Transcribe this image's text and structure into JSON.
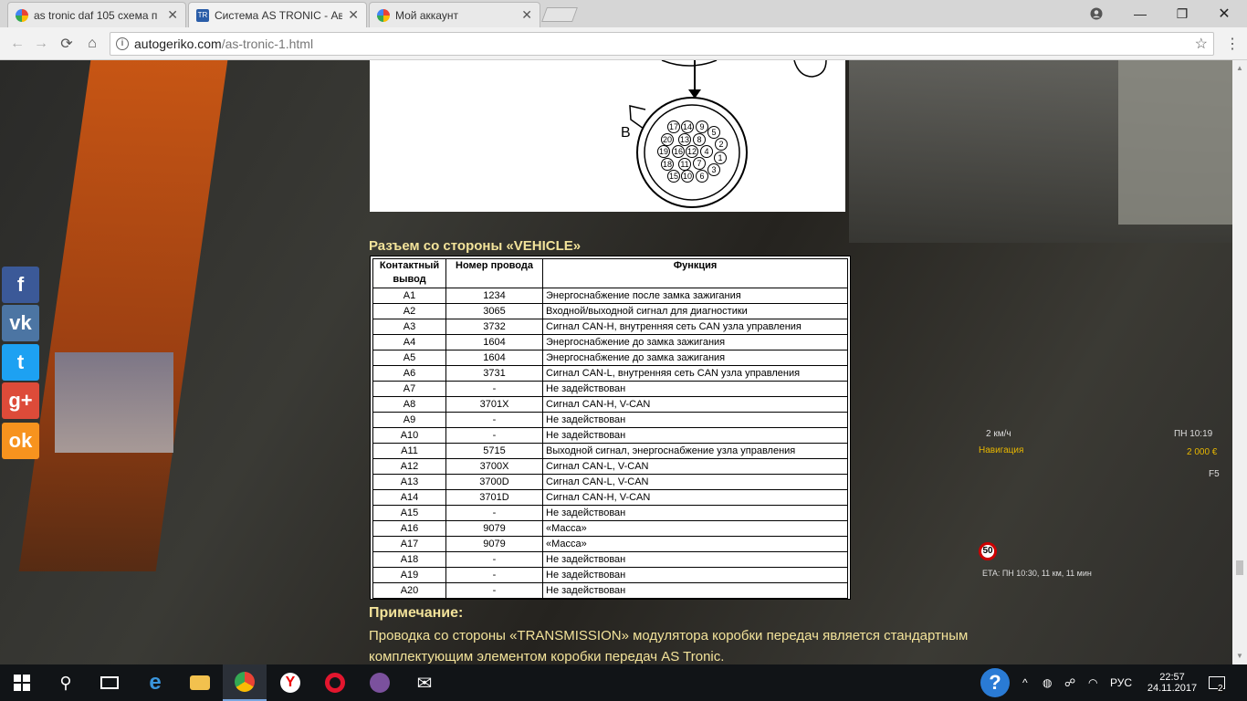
{
  "browser": {
    "tabs": [
      {
        "title": "as tronic daf 105 схема п",
        "favicon_color": "#4285f4"
      },
      {
        "title": "Система AS TRONIC - Ав",
        "favicon_color": "#2a5da8"
      },
      {
        "title": "Мой аккаунт",
        "favicon_color": "#4285f4"
      }
    ],
    "url_host": "autogeriko.com",
    "url_path": "/as-tronic-1.html"
  },
  "page": {
    "connector_label": "B",
    "section_heading": "Разъем со стороны «VEHICLE»",
    "table": {
      "headers": [
        "Контактный вывод",
        "Номер провода",
        "Функция"
      ],
      "rows": [
        [
          "A1",
          "1234",
          "Энергоснабжение после замка зажигания"
        ],
        [
          "A2",
          "3065",
          "Входной/выходной сигнал для диагностики"
        ],
        [
          "A3",
          "3732",
          "Сигнал CAN-H, внутренняя сеть CAN узла управления"
        ],
        [
          "A4",
          "1604",
          "Энергоснабжение до замка зажигания"
        ],
        [
          "A5",
          "1604",
          "Энергоснабжение до замка зажигания"
        ],
        [
          "A6",
          "3731",
          "Сигнал CAN-L, внутренняя сеть CAN узла управления"
        ],
        [
          "A7",
          "-",
          "Не задействован"
        ],
        [
          "A8",
          "3701X",
          "Сигнал CAN-H, V-CAN"
        ],
        [
          "A9",
          "-",
          "Не задействован"
        ],
        [
          "A10",
          "-",
          "Не задействован"
        ],
        [
          "A11",
          "5715",
          "Выходной сигнал, энергоснабжение узла управления"
        ],
        [
          "A12",
          "3700X",
          "Сигнал CAN-L, V-CAN"
        ],
        [
          "A13",
          "3700D",
          "Сигнал CAN-L, V-CAN"
        ],
        [
          "A14",
          "3701D",
          "Сигнал CAN-H, V-CAN"
        ],
        [
          "A15",
          "-",
          "Не задействован"
        ],
        [
          "A16",
          "9079",
          "«Масса»"
        ],
        [
          "A17",
          "9079",
          "«Масса»"
        ],
        [
          "A18",
          "-",
          "Не задействован"
        ],
        [
          "A19",
          "-",
          "Не задействован"
        ],
        [
          "A20",
          "-",
          "Не задействован"
        ]
      ]
    },
    "note_heading": "Примечание:",
    "note_text": "Проводка со стороны «TRANSMISSION» модулятора коробки передач является стандартным комплектующим элементом коробки передач AS Tronic."
  },
  "background_hud": {
    "speed": "2 км/ч",
    "nav": "Навигация",
    "clock": "ПН 10:19",
    "money": "2 000 €",
    "key": "F5",
    "speed_limit": "50",
    "eta": "ETA: ПН 10:30, 11 км, 11 мин"
  },
  "social": [
    {
      "name": "facebook",
      "color": "#3b5998",
      "glyph": "f"
    },
    {
      "name": "vk",
      "color": "#4c75a3",
      "glyph": "vk"
    },
    {
      "name": "twitter",
      "color": "#1da1f2",
      "glyph": "t"
    },
    {
      "name": "google-plus",
      "color": "#dd4b39",
      "glyph": "g+"
    },
    {
      "name": "odnoklassniki",
      "color": "#f7931e",
      "glyph": "ok"
    }
  ],
  "taskbar": {
    "lang": "РУС",
    "time": "22:57",
    "date": "24.11.2017",
    "notifications": "2"
  }
}
